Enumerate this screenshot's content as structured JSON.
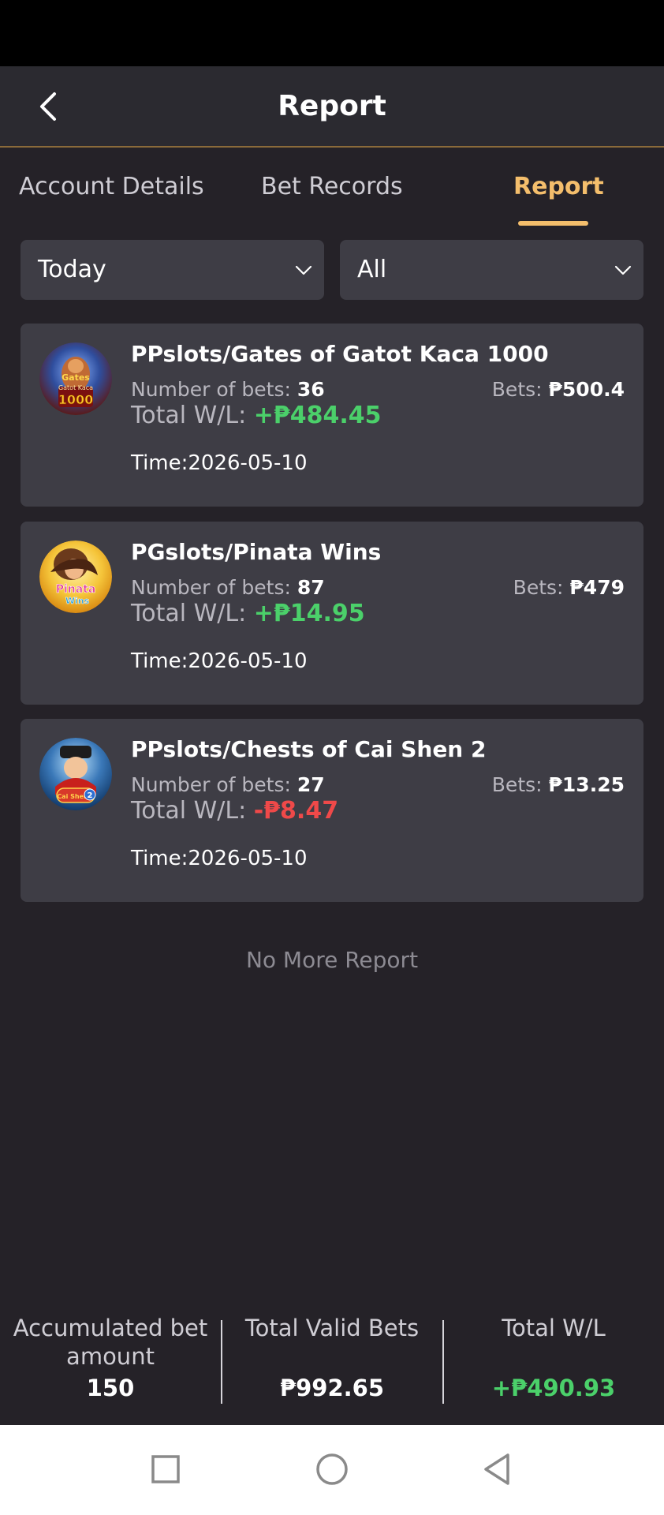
{
  "header": {
    "title": "Report"
  },
  "tabs": [
    {
      "label": "Account Details",
      "active": false
    },
    {
      "label": "Bet Records",
      "active": false
    },
    {
      "label": "Report",
      "active": true
    }
  ],
  "filters": {
    "date": {
      "selected": "Today"
    },
    "type": {
      "selected": "All"
    }
  },
  "labels": {
    "number_of_bets": "Number of bets: ",
    "bets": "Bets: ",
    "total_wl": "Total W/L: ",
    "time_prefix": "Time:"
  },
  "reports": [
    {
      "game": "PPslots/Gates of Gatot Kaca 1000",
      "thumb_icon": "gates-of-gatot-kaca-thumb",
      "thumb_text": [
        "Gates",
        "Gatot Kaca",
        "1000"
      ],
      "number_of_bets": "36",
      "bets": "₱500.4",
      "total_wl": "+₱484.45",
      "time": "2026-05-10"
    },
    {
      "game": "PGslots/Pinata Wins",
      "thumb_icon": "pinata-wins-thumb",
      "thumb_text": [
        "Pinata",
        "Wins"
      ],
      "number_of_bets": "87",
      "bets": "₱479",
      "total_wl": "+₱14.95",
      "time": "2026-05-10"
    },
    {
      "game": "PPslots/Chests of Cai Shen 2",
      "thumb_icon": "chests-of-cai-shen-thumb",
      "thumb_text": [
        "Cai Shen",
        "2"
      ],
      "number_of_bets": "27",
      "bets": "₱13.25",
      "total_wl": "-₱8.47",
      "time": "2026-05-10"
    }
  ],
  "footer_note": "No More Report",
  "summary": {
    "accumulated_label": "Accumulated bet amount",
    "accumulated_value": "150",
    "valid_bets_label": "Total Valid Bets",
    "valid_bets_value": "₱992.65",
    "total_wl_label": "Total W/L",
    "total_wl_value": "+₱490.93"
  },
  "colors": {
    "accent": "#f4be6c",
    "positive": "#4bd06a",
    "negative": "#ef4949",
    "card": "#3e3d45",
    "background": "#252228"
  },
  "nav": [
    "recent-apps-icon",
    "home-icon",
    "back-triangle-icon"
  ]
}
